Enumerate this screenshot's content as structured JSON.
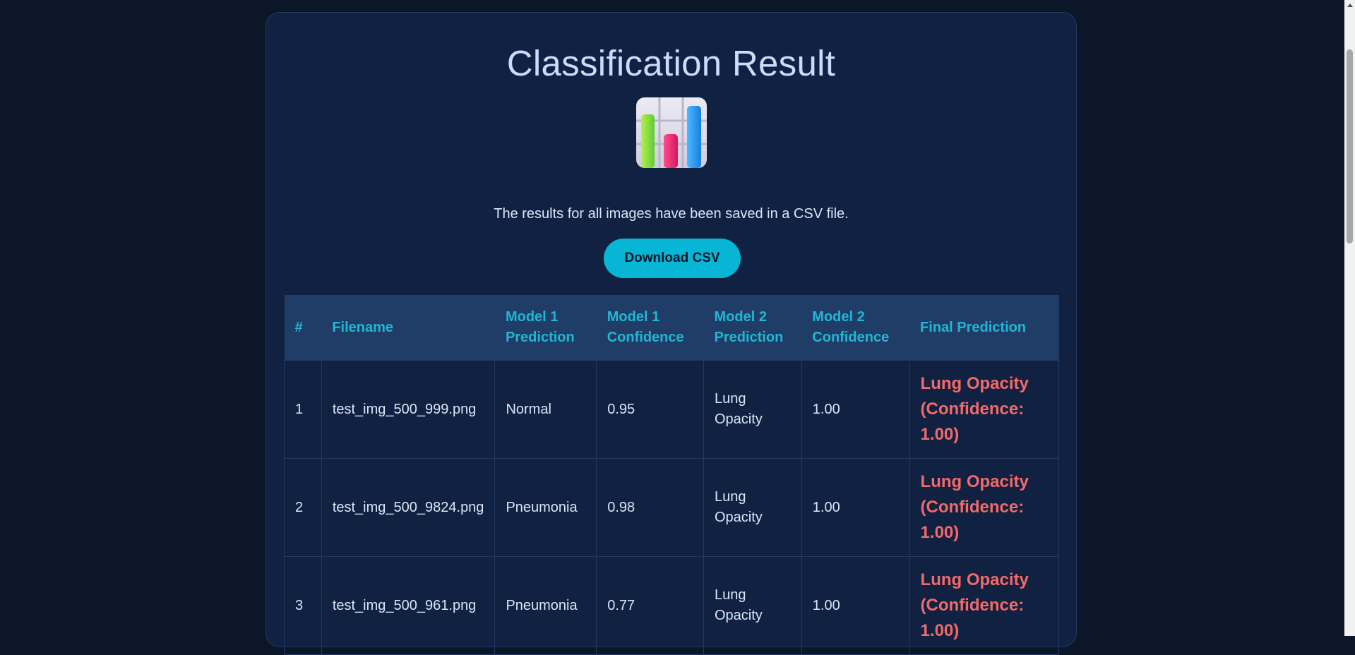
{
  "page": {
    "title": "Classification Result",
    "subtitle": "The results for all images have been saved in a CSV file.",
    "download_label": "Download CSV",
    "icon": "bar-chart-icon"
  },
  "table": {
    "headers": [
      "#",
      "Filename",
      "Model 1 Prediction",
      "Model 1 Confidence",
      "Model 2 Prediction",
      "Model 2 Confidence",
      "Final Prediction"
    ],
    "rows": [
      [
        "1",
        "test_img_500_999.png",
        "Normal",
        "0.95",
        "Lung Opacity",
        "1.00",
        "Lung Opacity (Confidence: 1.00)"
      ],
      [
        "2",
        "test_img_500_9824.png",
        "Pneumonia",
        "0.98",
        "Lung Opacity",
        "1.00",
        "Lung Opacity (Confidence: 1.00)"
      ],
      [
        "3",
        "test_img_500_961.png",
        "Pneumonia",
        "0.77",
        "Lung Opacity",
        "1.00",
        "Lung Opacity (Confidence: 1.00)"
      ]
    ]
  },
  "colors": {
    "background": "#0b1628",
    "card": "#112141",
    "accent": "#06b6d4",
    "final_prediction": "#f26a6a"
  }
}
